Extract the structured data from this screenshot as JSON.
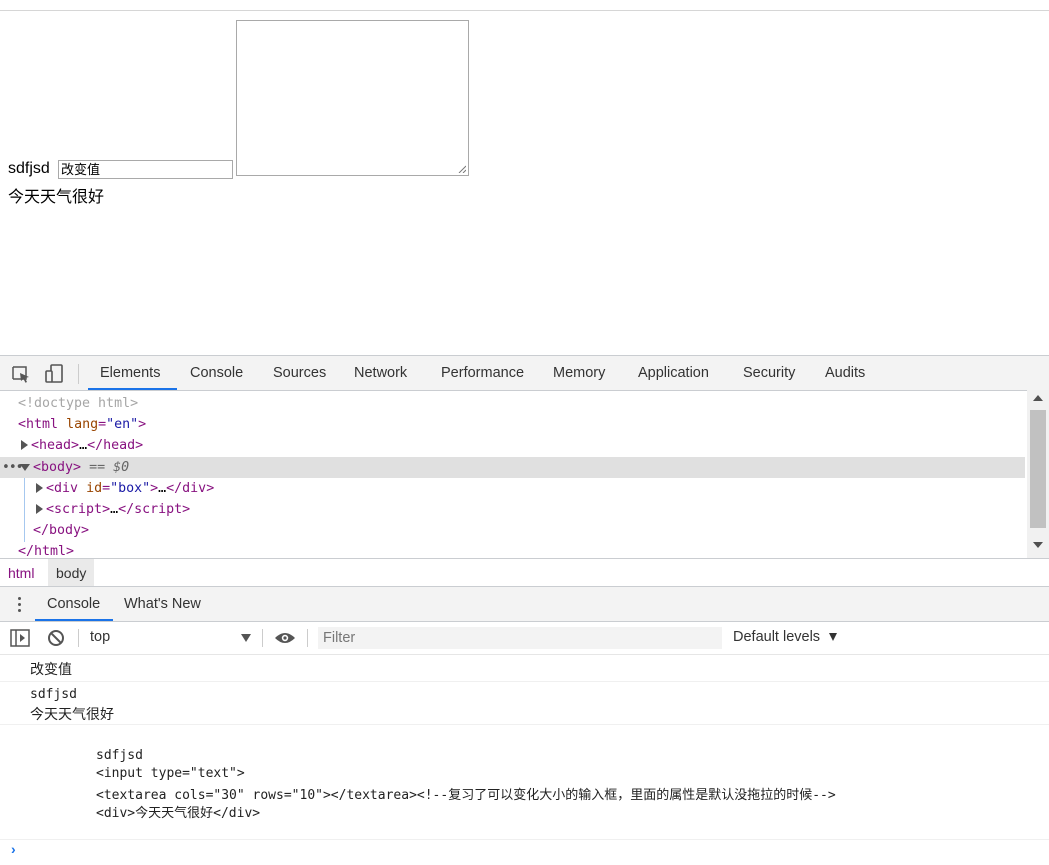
{
  "page": {
    "box_text": "sdfjsd",
    "input_value": "改变值",
    "div_text": "今天天气很好"
  },
  "devtools": {
    "tabs": [
      "Elements",
      "Console",
      "Sources",
      "Network",
      "Performance",
      "Memory",
      "Application",
      "Security",
      "Audits"
    ],
    "active_tab": "Elements",
    "elements": {
      "doctype": "<!doctype html>",
      "html_open_tag": "html",
      "html_lang_attr": "lang",
      "html_lang_value": "\"en\"",
      "head_tag": "head",
      "body_tag": "body",
      "body_marker": "== $0",
      "div_tag": "div",
      "div_id_attr": "id",
      "div_id_value": "\"box\"",
      "script_tag": "script",
      "ellipsis": "…",
      "body_close": "</body>",
      "html_close": "</html>"
    },
    "breadcrumbs": [
      "html",
      "body"
    ],
    "drawer_tabs": [
      "Console",
      "What's New"
    ],
    "console_toolbar": {
      "context": "top",
      "filter_placeholder": "Filter",
      "levels": "Default levels"
    },
    "console_messages": [
      [
        "改变值"
      ],
      [
        "sdfjsd",
        "今天天气很好"
      ],
      [
        "sdfjsd",
        "<input type=\"text\">",
        "<textarea cols=\"30\" rows=\"10\"></textarea><!--复习了可以变化大小的输入框，里面的属性是默认没拖拉的时候-->",
        "<div>今天天气很好</div>"
      ]
    ],
    "prompt": "›"
  }
}
